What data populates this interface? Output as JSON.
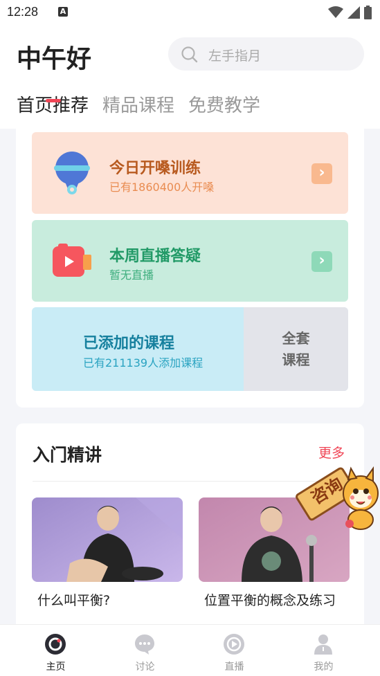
{
  "status": {
    "time": "12:28",
    "notification_glyph": "A"
  },
  "header": {
    "greeting": "中午好",
    "search_placeholder": "左手指月",
    "tabs": [
      {
        "label": "首页推荐",
        "active": true
      },
      {
        "label": "精品课程",
        "active": false
      },
      {
        "label": "免费教学",
        "active": false
      }
    ]
  },
  "cards": {
    "training": {
      "title": "今日开嗓训练",
      "subtitle": "已有1860400人开嗓",
      "icon": "microphone-icon",
      "color": "#fde2d6"
    },
    "live": {
      "title": "本周直播答疑",
      "subtitle": "暂无直播",
      "icon": "camera-icon",
      "color": "#c8ecdd"
    },
    "courses": {
      "title": "已添加的课程",
      "subtitle": "已有211139人添加课程",
      "all_line1": "全套",
      "all_line2": "课程",
      "color": "#c9ecf6"
    }
  },
  "section": {
    "title": "入门精讲",
    "more": "更多",
    "videos": [
      {
        "title": "什么叫平衡?"
      },
      {
        "title": "位置平衡的概念及练习"
      }
    ]
  },
  "mascot": {
    "sign_text": "咨询"
  },
  "nav": [
    {
      "label": "主页",
      "icon": "home-icon",
      "active": true
    },
    {
      "label": "讨论",
      "icon": "chat-icon",
      "active": false
    },
    {
      "label": "直播",
      "icon": "live-play-icon",
      "active": false
    },
    {
      "label": "我的",
      "icon": "profile-icon",
      "active": false
    }
  ],
  "colors": {
    "accent": "#f04656"
  }
}
